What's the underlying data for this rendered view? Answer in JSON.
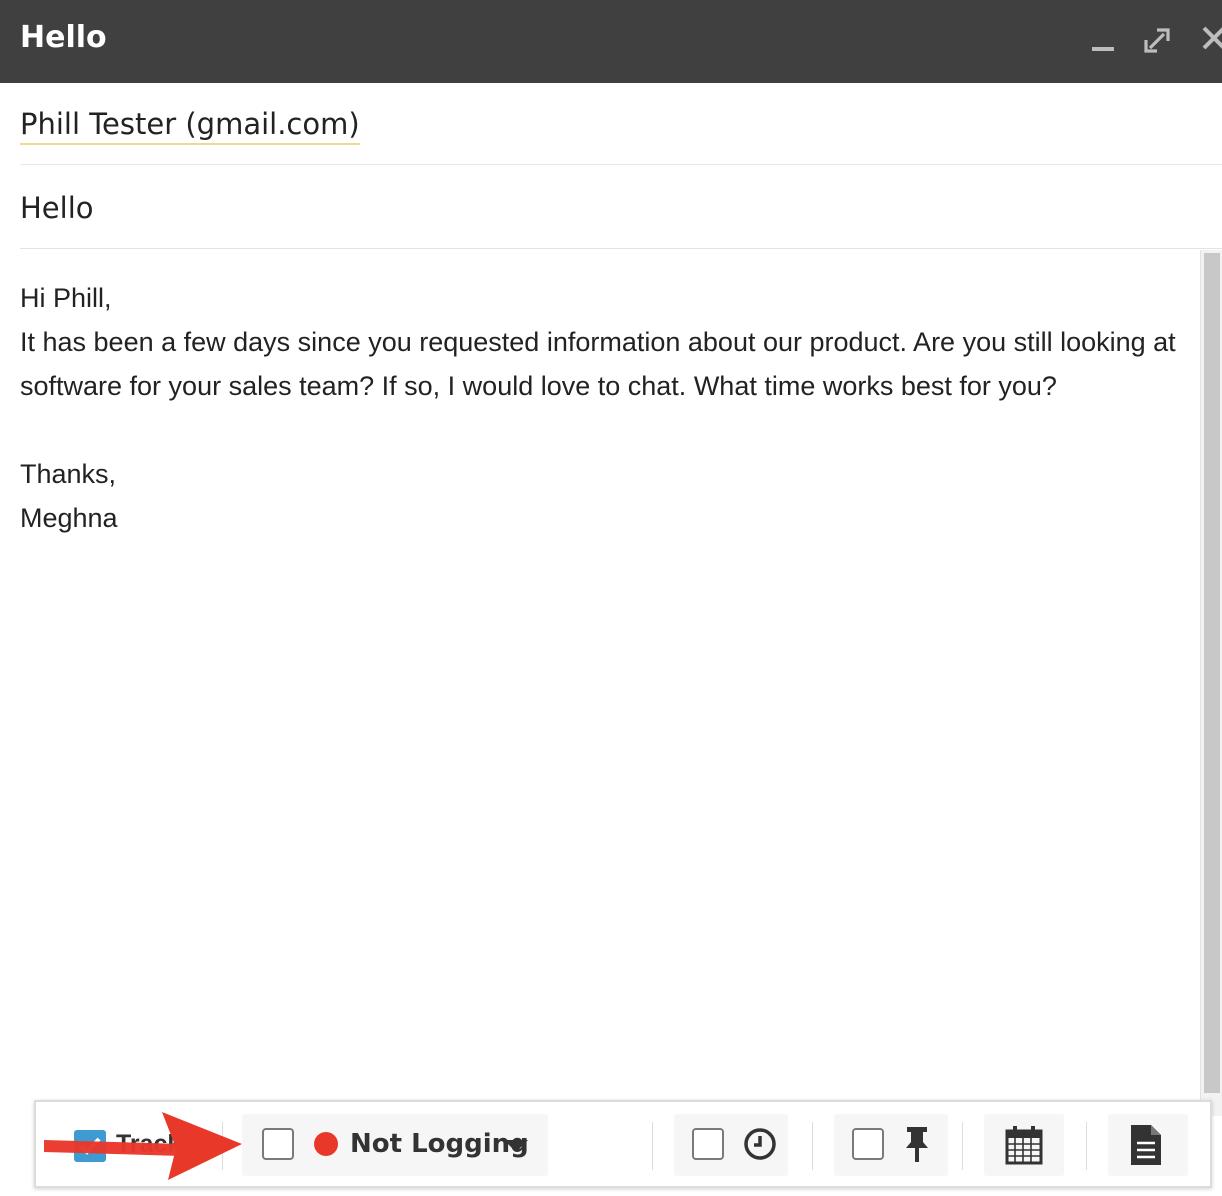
{
  "window": {
    "title": "Hello"
  },
  "compose": {
    "recipient": "Phill Tester (gmail.com)",
    "subject": "Hello",
    "body_lines": [
      "Hi Phill,",
      "It has been a few days since you requested information about our product. Are you still looking at software for your sales team? If so, I would love to chat. What time works best for you?",
      "",
      "Thanks,",
      "Meghna"
    ]
  },
  "toolbar": {
    "track_label": "Track",
    "track_checked": true,
    "logging_label": "Not Logging",
    "logging_checked": false,
    "logging_status_color": "#e8382a",
    "schedule_checked": false,
    "pin_checked": false,
    "icons": [
      "clock-icon",
      "pin-icon",
      "calendar-icon",
      "document-icon"
    ]
  },
  "colors": {
    "titlebar": "#404040",
    "accent_blue": "#3e9bd2",
    "annotation_arrow": "#e8382a"
  }
}
